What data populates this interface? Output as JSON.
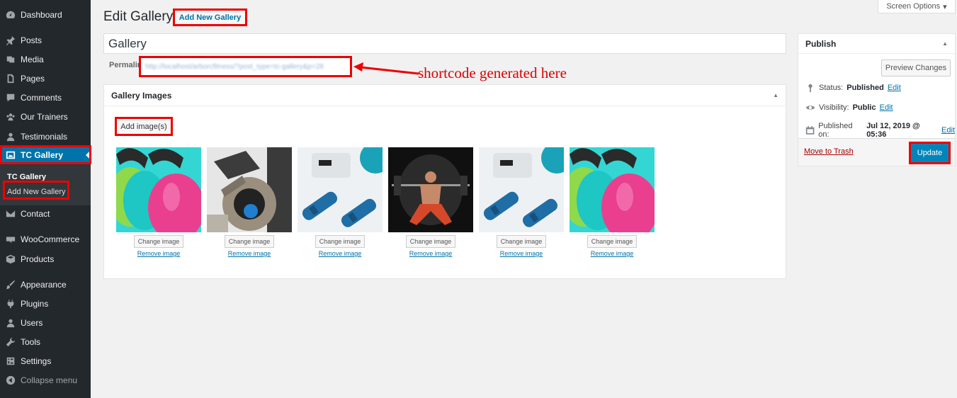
{
  "sidebar": {
    "items": [
      {
        "label": "Dashboard",
        "icon": "dashboard-icon"
      },
      {
        "label": "Posts",
        "icon": "pin-icon"
      },
      {
        "label": "Media",
        "icon": "media-icon"
      },
      {
        "label": "Pages",
        "icon": "pages-icon"
      },
      {
        "label": "Comments",
        "icon": "comment-icon"
      },
      {
        "label": "Our Trainers",
        "icon": "groups-icon"
      },
      {
        "label": "Testimonials",
        "icon": "user-icon"
      },
      {
        "label": "TC Gallery",
        "icon": "gallery-icon"
      },
      {
        "label": "Contact",
        "icon": "mail-icon"
      },
      {
        "label": "WooCommerce",
        "icon": "woo-icon"
      },
      {
        "label": "Products",
        "icon": "box-icon"
      },
      {
        "label": "Appearance",
        "icon": "brush-icon"
      },
      {
        "label": "Plugins",
        "icon": "plug-icon"
      },
      {
        "label": "Users",
        "icon": "users-icon"
      },
      {
        "label": "Tools",
        "icon": "wrench-icon"
      },
      {
        "label": "Settings",
        "icon": "settings-icon"
      },
      {
        "label": "Collapse menu",
        "icon": "collapse-icon"
      }
    ],
    "submenu": {
      "current": "TC Gallery",
      "add_new": "Add New Gallery"
    }
  },
  "screen_options": "Screen Options",
  "header": {
    "title": "Edit Gallery",
    "add_new": "Add New Gallery"
  },
  "post": {
    "title": "Gallery",
    "permalink_label": "Permalink:",
    "permalink_url": "http://localhost/arborcfitness/?post_type=tc-gallery&p=28"
  },
  "annotation": "shortcode generated here",
  "gallery": {
    "heading": "Gallery Images",
    "add_button": "Add image(s)",
    "change_label": "Change image",
    "remove_label": "Remove image",
    "images": [
      "kettlebells",
      "exercise-bike",
      "dumbbells-scale",
      "barbell-lifter",
      "dumbbells-scale",
      "kettlebells"
    ]
  },
  "publish": {
    "heading": "Publish",
    "preview": "Preview Changes",
    "status_label": "Status:",
    "status_value": "Published",
    "visibility_label": "Visibility:",
    "visibility_value": "Public",
    "published_label": "Published on:",
    "published_value": "Jul 12, 2019 @ 05:36",
    "edit": "Edit",
    "trash": "Move to Trash",
    "update": "Update"
  },
  "colors": {
    "accent": "#0073aa",
    "highlight": "#ee0000",
    "sidebar": "#23282d"
  }
}
